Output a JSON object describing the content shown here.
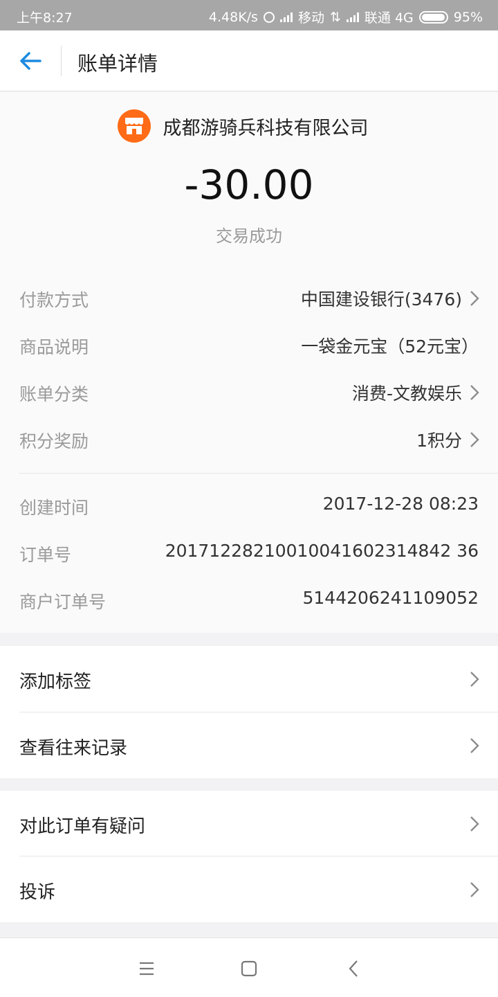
{
  "status_bar": {
    "time": "上午8:27",
    "net_speed": "4.48K/s",
    "carrier1": "移动",
    "carrier2": "联通 4G",
    "battery": "95%"
  },
  "header": {
    "title": "账单详情",
    "back_icon": "arrow-left-icon"
  },
  "summary": {
    "merchant_name": "成都游骑兵科技有限公司",
    "merchant_icon": "store-icon",
    "amount": "-30.00",
    "status": "交易成功"
  },
  "details": {
    "payment_method": {
      "label": "付款方式",
      "value": "中国建设银行(3476)"
    },
    "product_desc": {
      "label": "商品说明",
      "value": "一袋金元宝（52元宝）"
    },
    "category": {
      "label": "账单分类",
      "value": "消费-文教娱乐"
    },
    "points": {
      "label": "积分奖励",
      "value": "1积分"
    },
    "created_time": {
      "label": "创建时间",
      "value": "2017-12-28 08:23"
    },
    "order_no": {
      "label": "订单号",
      "value": "20171228210010041602314842 36"
    },
    "merchant_order_no": {
      "label": "商户订单号",
      "value": "5144206241109052"
    }
  },
  "actions": {
    "add_tag": "添加标签",
    "view_records": "查看往来记录",
    "order_question": "对此订单有疑问",
    "complain": "投诉"
  },
  "colors": {
    "accent_blue": "#1c8be0",
    "merchant_orange": "#ff6b16",
    "status_bar": "#a7a7a7"
  },
  "navbar": {
    "menu_icon": "menu-icon",
    "home_icon": "home-icon",
    "back_icon": "back-chevron-icon"
  }
}
